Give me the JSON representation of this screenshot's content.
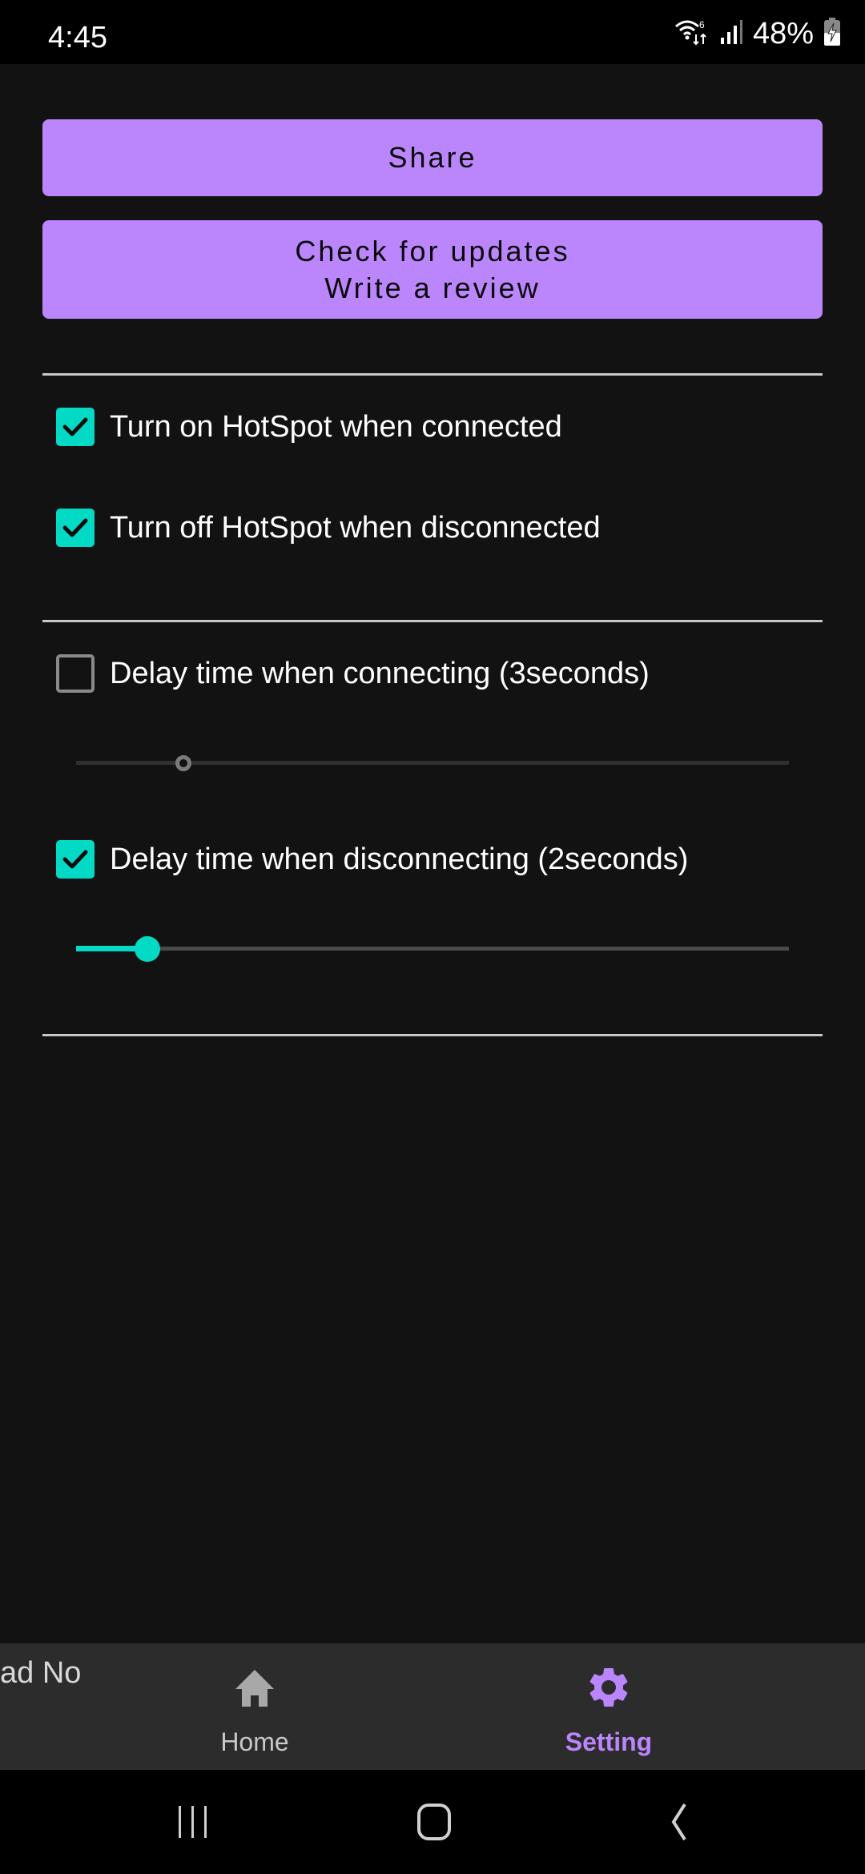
{
  "status_bar": {
    "time": "4:45",
    "wifi_icon": "wifi-6-icon",
    "signal_icon": "cell-signal-icon",
    "battery_percent": "48%",
    "battery_icon": "battery-charging-icon"
  },
  "buttons": {
    "share_label": "Share",
    "updates_line1": "Check for updates",
    "updates_line2": "Write a review"
  },
  "settings": {
    "hotspot_on": {
      "label": "Turn on HotSpot when connected",
      "checked": true
    },
    "hotspot_off": {
      "label": "Turn off HotSpot when disconnected",
      "checked": true
    },
    "delay_connect": {
      "label": "Delay time when connecting (3seconds)",
      "checked": false,
      "slider_value": 3,
      "slider_fraction": 0.15
    },
    "delay_disconnect": {
      "label": "Delay time when disconnecting (2seconds)",
      "checked": true,
      "slider_value": 2,
      "slider_fraction": 0.1
    }
  },
  "colors": {
    "accent_purple": "#bb86fc",
    "accent_teal": "#03dac5",
    "background": "#121212",
    "nav_background": "#2c2c2c"
  },
  "bottom_nav": {
    "ad_text": "ad No",
    "items": [
      {
        "label": "Home",
        "icon": "home-icon",
        "active": false
      },
      {
        "label": "Setting",
        "icon": "gear-icon",
        "active": true
      }
    ]
  },
  "system_nav": {
    "recents": "recents-icon",
    "home": "home-circle-icon",
    "back": "back-icon"
  }
}
